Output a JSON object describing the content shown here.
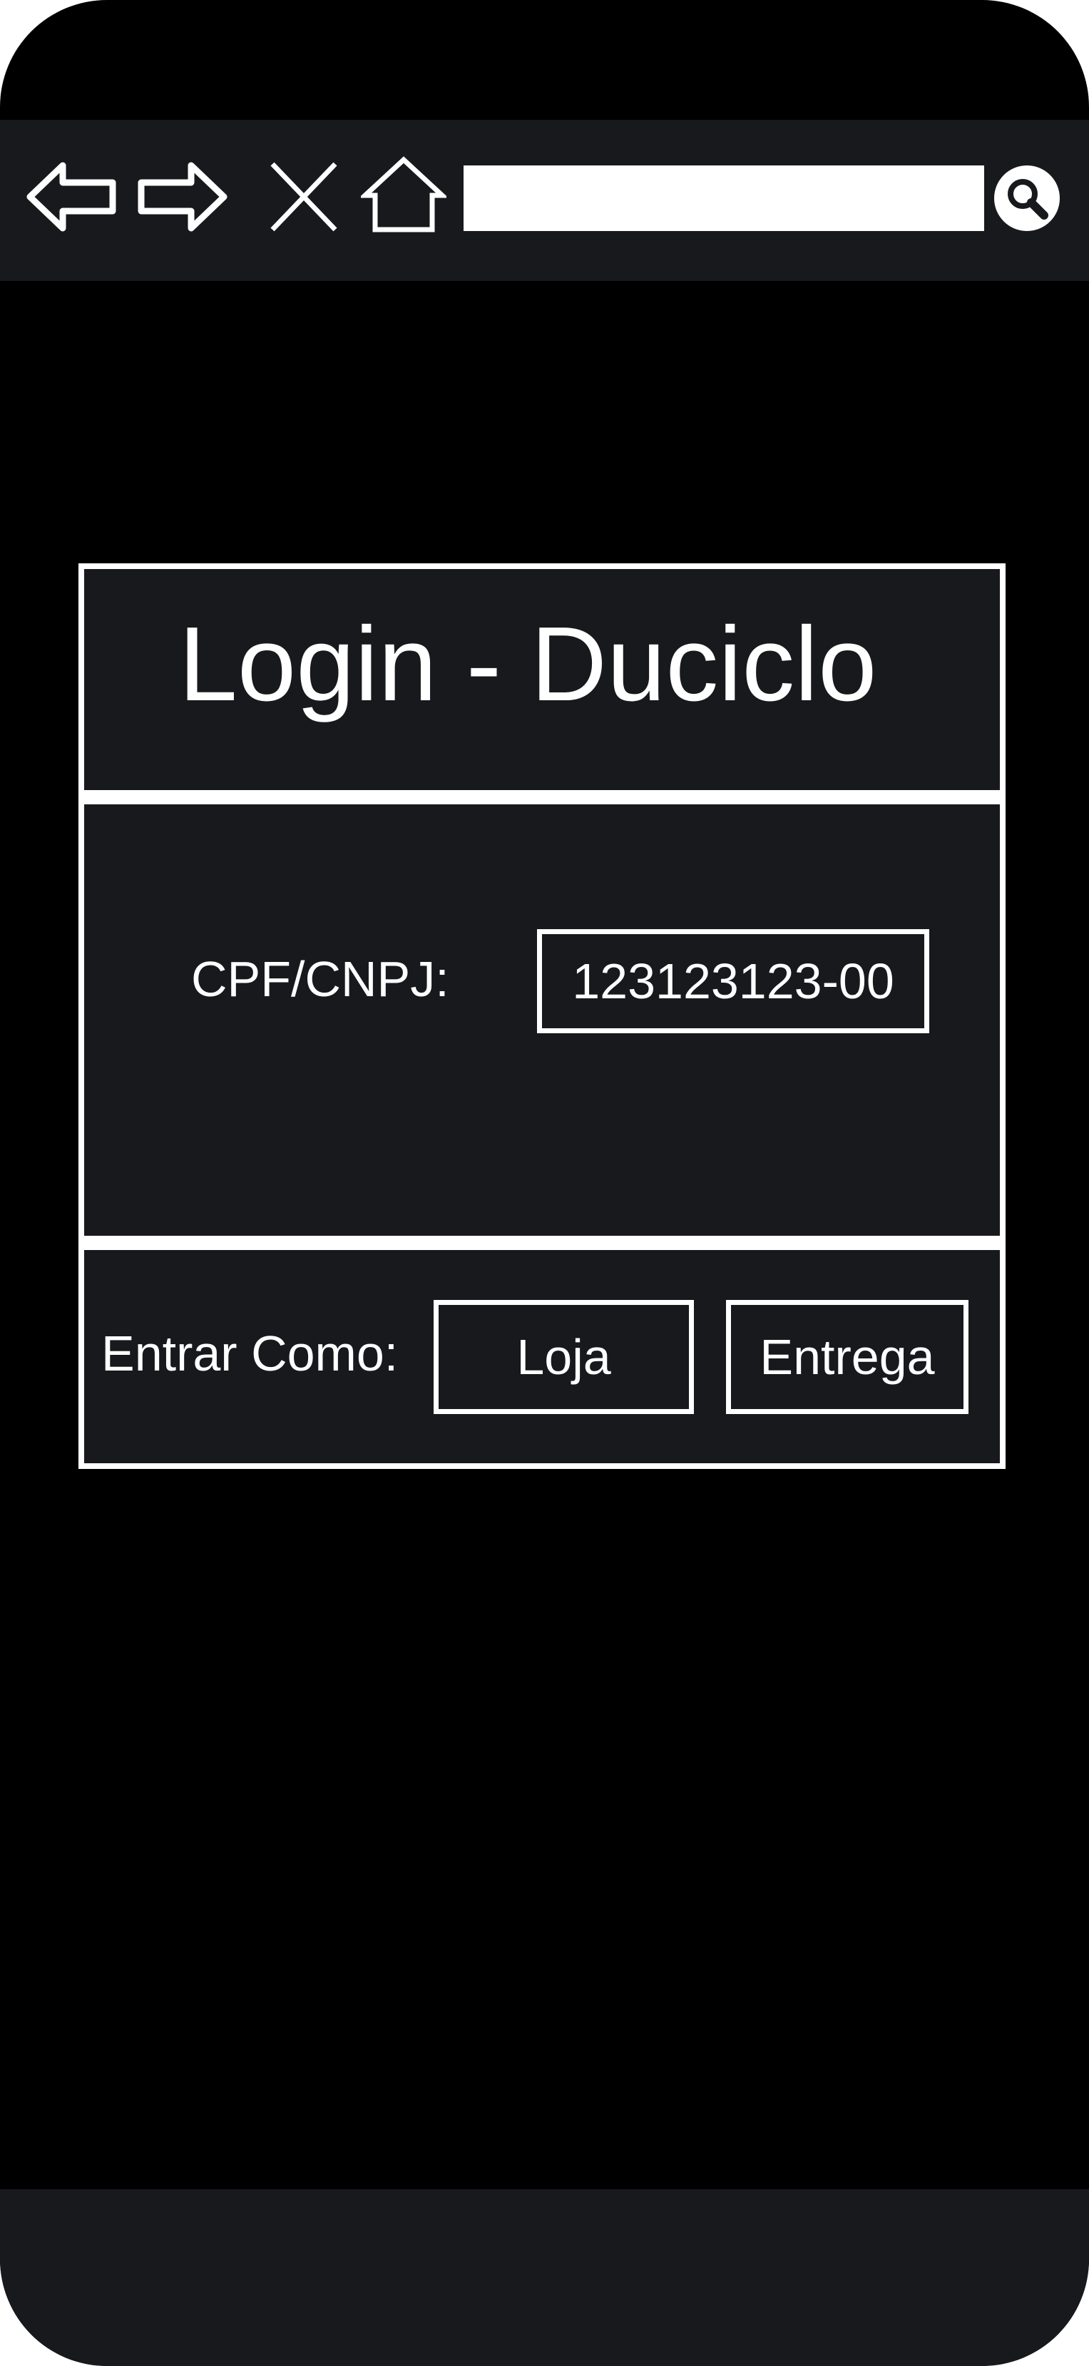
{
  "browser": {
    "icons": [
      "back-arrow-icon",
      "forward-arrow-icon",
      "close-icon",
      "home-icon",
      "search-icon"
    ],
    "url_value": ""
  },
  "login": {
    "title": "Login - Duciclo",
    "cpf_label": "CPF/CNPJ:",
    "cpf_value": "123123123-00",
    "entrar_label": "Entrar Como:",
    "role_buttons": [
      "Loja",
      "Entrega"
    ]
  },
  "colors": {
    "device_background": "#000000",
    "panel_background": "#17191d",
    "foreground": "#ffffff"
  }
}
